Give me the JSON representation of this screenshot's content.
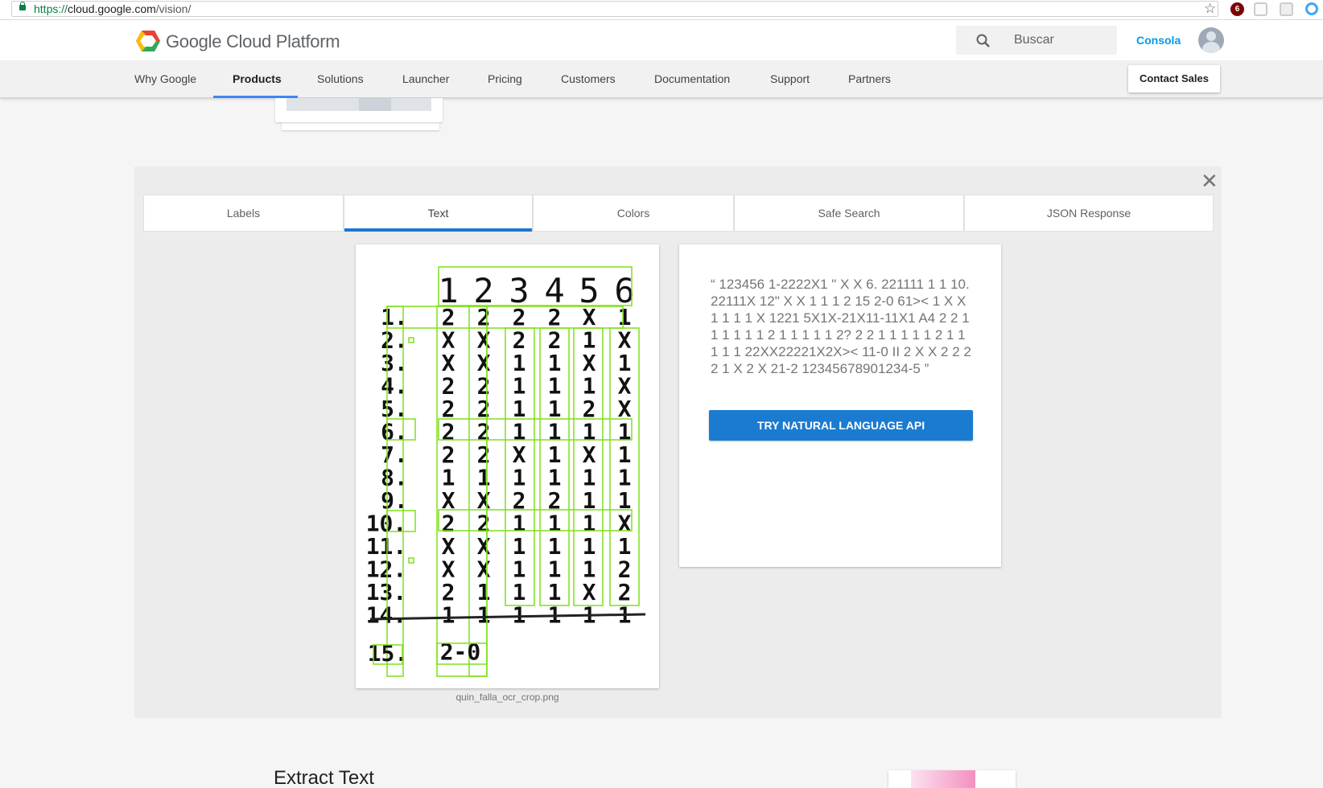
{
  "browser": {
    "url_scheme": "https://",
    "url_host": "cloud.google.com",
    "url_path": "/vision/",
    "star_icon": "star-icon",
    "ublock_badge": "6"
  },
  "header": {
    "brand": "Google Cloud Platform",
    "search_placeholder": "Buscar",
    "console_label": "Consola"
  },
  "nav": {
    "items": [
      "Why Google",
      "Products",
      "Solutions",
      "Launcher",
      "Pricing",
      "Customers",
      "Documentation",
      "Support",
      "Partners"
    ],
    "active": "Products",
    "contact_label": "Contact Sales"
  },
  "results": {
    "tabs": [
      "Labels",
      "Text",
      "Colors",
      "Safe Search",
      "JSON Response"
    ],
    "active_tab": "Text",
    "image_caption": "quin_falla_ocr_crop.png",
    "detected_text": "“ 123456 1-2222X1 \" X X 6. 221111 1 1 10. 22111X 12\" X X 1 1 1 2 15 2-0 61>< 1 X X 1 1 1 1 X 1221 5X1X-21X11-11X1 A4 2 2 1 1 1 1 1 1 2 1 1 1 1 1 2? 2 2 1 1 1 1 1 2 1 1 1 1 1 22XX22221X2X>< 11-0 II 2 X X 2 2 2 2 1 X 2 X 21-2 12345678901234-5 ”",
    "nl_button": "TRY NATURAL LANGUAGE API"
  },
  "sheet": {
    "header": [
      "1",
      "2",
      "3",
      "4",
      "5",
      "6"
    ],
    "rows": [
      {
        "label": "1.",
        "cells": [
          "2",
          "2",
          "2",
          "2",
          "X",
          "1"
        ]
      },
      {
        "label": "2.",
        "cells": [
          "X",
          "X",
          "2",
          "2",
          "1",
          "X"
        ]
      },
      {
        "label": "3.",
        "cells": [
          "X",
          "X",
          "1",
          "1",
          "X",
          "1"
        ]
      },
      {
        "label": "4.",
        "cells": [
          "2",
          "2",
          "1",
          "1",
          "1",
          "X"
        ]
      },
      {
        "label": "5.",
        "cells": [
          "2",
          "2",
          "1",
          "1",
          "2",
          "X"
        ]
      },
      {
        "label": "6.",
        "cells": [
          "2",
          "2",
          "1",
          "1",
          "1",
          "1"
        ]
      },
      {
        "label": "7.",
        "cells": [
          "2",
          "2",
          "X",
          "1",
          "X",
          "1"
        ]
      },
      {
        "label": "8.",
        "cells": [
          "1",
          "1",
          "1",
          "1",
          "1",
          "1"
        ]
      },
      {
        "label": "9.",
        "cells": [
          "X",
          "X",
          "2",
          "2",
          "1",
          "1"
        ]
      },
      {
        "label": "10.",
        "cells": [
          "2",
          "2",
          "1",
          "1",
          "1",
          "X"
        ]
      },
      {
        "label": "11.",
        "cells": [
          "X",
          "X",
          "1",
          "1",
          "1",
          "1"
        ]
      },
      {
        "label": "12.",
        "cells": [
          "X",
          "X",
          "1",
          "1",
          "1",
          "2"
        ]
      },
      {
        "label": "13.",
        "cells": [
          "2",
          "1",
          "1",
          "1",
          "X",
          "2"
        ]
      },
      {
        "label": "14.",
        "cells": [
          "1",
          "1",
          "1",
          "1",
          "1",
          "1"
        ]
      }
    ],
    "final_label": "15.",
    "final_value": "2-0"
  },
  "footer": {
    "section_title": "Extract Text"
  },
  "colors": {
    "accent": "#1976d2",
    "button": "#1a7bd0",
    "link": "#039be5",
    "ocr_box": "#7fe01a"
  }
}
